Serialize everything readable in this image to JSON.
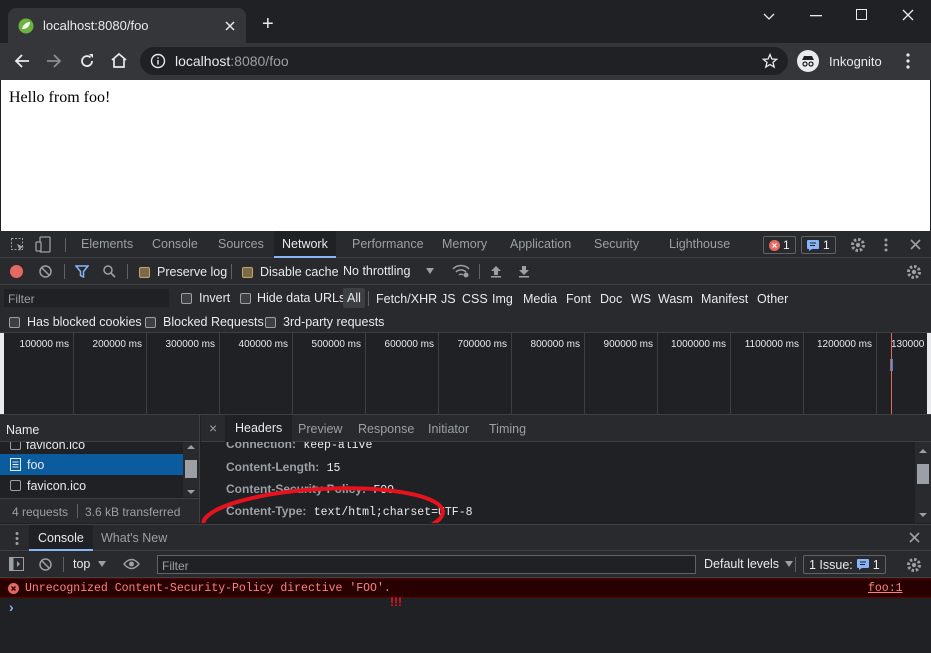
{
  "browser": {
    "tab_title": "localhost:8080/foo",
    "url_host": "localhost",
    "url_rest": ":8080/foo",
    "profile_label": "Inkognito",
    "new_tab_symbol": "+"
  },
  "page": {
    "content_text": "Hello from foo!"
  },
  "devtools": {
    "tabs": [
      "Elements",
      "Console",
      "Sources",
      "Network",
      "Performance",
      "Memory",
      "Application",
      "Security",
      "Lighthouse"
    ],
    "active_tab": "Network",
    "error_count": "1",
    "message_count": "1",
    "network_toolbar": {
      "preserve_log_label": "Preserve log",
      "disable_cache_label": "Disable cache",
      "throttling_value": "No throttling"
    },
    "filter_bar": {
      "filter_placeholder": "Filter",
      "invert_label": "Invert",
      "hide_data_urls_label": "Hide data URLs",
      "type_filters": [
        "All",
        "Fetch/XHR",
        "JS",
        "CSS",
        "Img",
        "Media",
        "Font",
        "Doc",
        "WS",
        "Wasm",
        "Manifest",
        "Other"
      ],
      "has_blocked_cookies_label": "Has blocked cookies",
      "blocked_requests_label": "Blocked Requests",
      "third_party_label": "3rd-party requests"
    },
    "overview_ticks": [
      "100000 ms",
      "200000 ms",
      "300000 ms",
      "400000 ms",
      "500000 ms",
      "600000 ms",
      "700000 ms",
      "800000 ms",
      "900000 ms",
      "1000000 ms",
      "1100000 ms",
      "1200000 ms",
      "130000"
    ],
    "requests": {
      "name_header": "Name",
      "items": [
        "favicon.ico",
        "foo",
        "favicon.ico"
      ],
      "summary_requests": "4 requests",
      "summary_transferred": "3.6 kB transferred"
    },
    "details": {
      "tabs": [
        "Headers",
        "Preview",
        "Response",
        "Initiator",
        "Timing"
      ],
      "active_tab": "Headers",
      "close_symbol": "×",
      "headers": [
        {
          "name": "Connection:",
          "value": "keep-alive"
        },
        {
          "name": "Content-Length:",
          "value": "15"
        },
        {
          "name": "Content-Security-Policy:",
          "value": "FOO"
        },
        {
          "name": "Content-Type:",
          "value": "text/html;charset=UTF-8"
        }
      ]
    },
    "drawer": {
      "tabs": [
        "Console",
        "What's New"
      ],
      "context_value": "top",
      "filter_placeholder": "Filter",
      "levels_label": "Default levels",
      "issues_label": "1 Issue:",
      "issues_count": "1"
    },
    "console": {
      "error_message": "Unrecognized Content-Security-Policy directive 'FOO'.",
      "error_source": "foo:1",
      "annotation": "!!!",
      "prompt_symbol": "›"
    }
  },
  "colors": {
    "annotation_red": "#e8121f",
    "selected_row": "#0a5c9e",
    "error_text": "#ff8080",
    "accent_blue": "#8ab4f8"
  },
  "icons": [
    "spring-leaf-icon",
    "close-icon",
    "back-arrow-icon",
    "forward-arrow-icon",
    "reload-icon",
    "home-icon",
    "info-icon",
    "star-icon",
    "incognito-icon",
    "kebab-menu-icon",
    "inspect-icon",
    "device-icon",
    "gear-icon",
    "record-icon",
    "clear-icon",
    "filter-icon",
    "search-icon",
    "wifi-icon",
    "upload-icon",
    "download-icon",
    "document-icon",
    "sidebar-icon",
    "eye-icon",
    "error-icon",
    "chat-icon"
  ]
}
